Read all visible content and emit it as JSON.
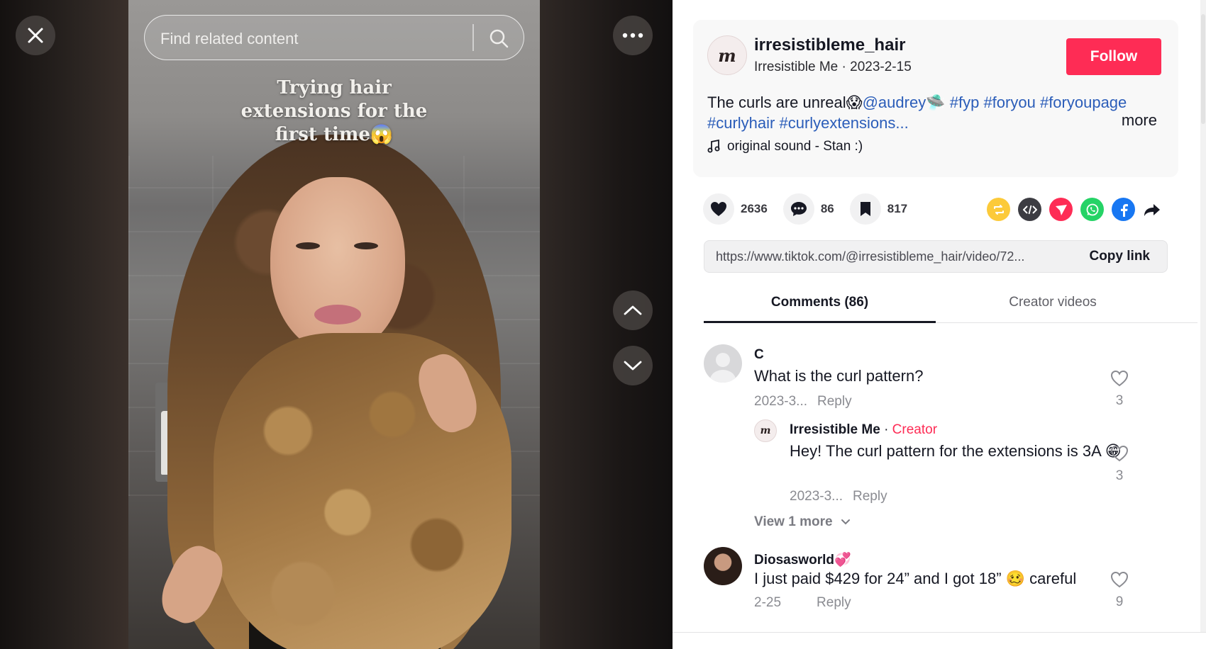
{
  "viewer": {
    "search_placeholder": "Find related content",
    "caption_lines": [
      "Trying hair",
      "extensions for the",
      "first time😱"
    ]
  },
  "post": {
    "username": "irresistibleme_hair",
    "display_name": "Irresistible Me",
    "date": "2023-2-15",
    "follow_label": "Follow",
    "desc_plain": "The curls are unreal😱",
    "desc_tags_line1": [
      "@audrey🛸",
      "#fyp",
      "#foryou",
      "#foryoupage"
    ],
    "desc_tags_line2": "#curlyhair #curlyextensions...",
    "more_label": "more",
    "sound": "original sound - Stan :)"
  },
  "stats": {
    "likes": "2636",
    "comments": "86",
    "saves": "817"
  },
  "link": {
    "url": "https://www.tiktok.com/@irresistibleme_hair/video/72...",
    "copy_label": "Copy link"
  },
  "tabs": {
    "comments": "Comments (86)",
    "creator": "Creator videos"
  },
  "comments": [
    {
      "name": "C",
      "text": "What is the curl pattern?",
      "date": "2023-3...",
      "reply": "Reply",
      "likes": "3"
    },
    {
      "name": "Irresistible Me",
      "separator": "·",
      "badge": "Creator",
      "text": "Hey! The curl pattern for the extensions is 3A 😁",
      "date": "2023-3...",
      "reply": "Reply",
      "likes": "3"
    },
    {
      "name": "Diosasworld💞",
      "text": "I just paid $429 for 24” and I got 18” 🥴 careful",
      "date": "2-25",
      "reply": "Reply",
      "likes": "9"
    }
  ],
  "view_more": "View 1 more",
  "colors": {
    "accent": "#fe2c55",
    "hashtag": "#2b5db9",
    "text": "#161823",
    "muted": "#8a8b91"
  }
}
